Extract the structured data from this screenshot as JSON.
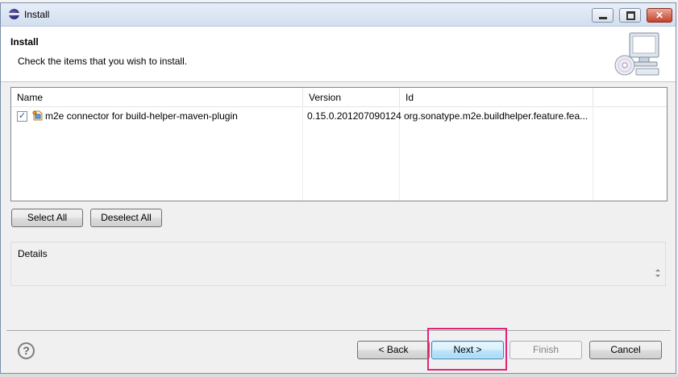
{
  "window": {
    "title": "Install"
  },
  "header": {
    "title": "Install",
    "description": "Check the items that you wish to install."
  },
  "table": {
    "columns": [
      "Name",
      "Version",
      "Id"
    ],
    "rows": [
      {
        "checked": true,
        "check_glyph": "✓",
        "name": "m2e connector for build-helper-maven-plugin",
        "version": "0.15.0.201207090124",
        "id": "org.sonatype.m2e.buildhelper.feature.fea..."
      }
    ]
  },
  "buttons": {
    "select_all": "Select All",
    "deselect_all": "Deselect All",
    "back": "< Back",
    "next": "Next >",
    "finish": "Finish",
    "cancel": "Cancel"
  },
  "details": {
    "label": "Details"
  },
  "help": {
    "glyph": "?"
  },
  "titlebar_controls": {
    "close_glyph": "✕"
  },
  "colors": {
    "highlight": "#e0247a",
    "default_button_border": "#3c7fb1"
  },
  "icons": [
    "eclipse-icon",
    "minimize-icon",
    "maximize-icon",
    "close-icon",
    "monitor-cd-icon",
    "plugin-feature-icon",
    "help-icon"
  ]
}
